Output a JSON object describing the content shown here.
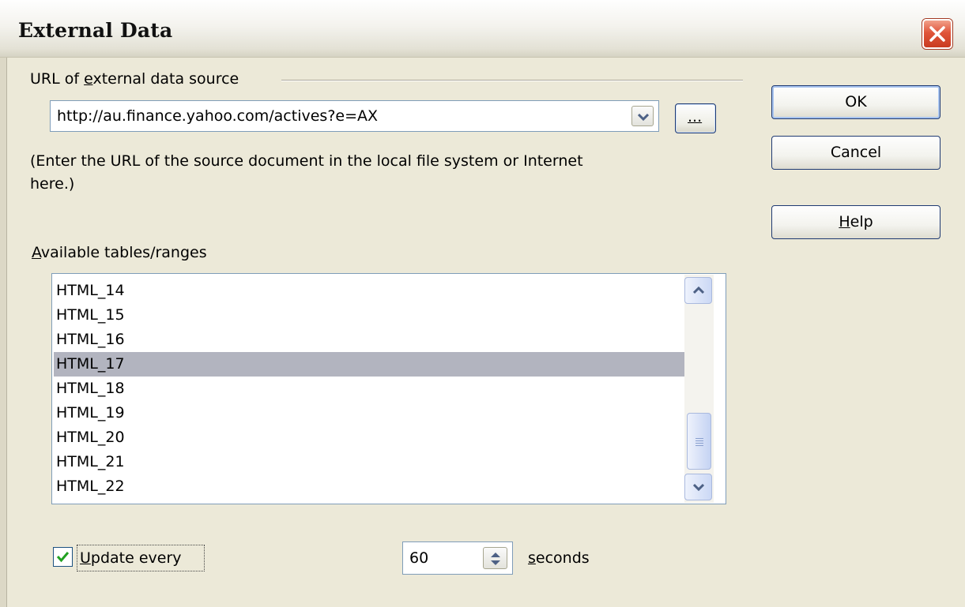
{
  "window": {
    "title": "External Data",
    "close_icon": "close-icon"
  },
  "url_group": {
    "label_pre": "URL of ",
    "label_accel": "e",
    "label_post": "xternal data source",
    "url_value": "http://au.finance.yahoo.com/actives?e=AX",
    "browse_label": "...",
    "hint_line1": "(Enter the URL of the source document in the local file system or Internet",
    "hint_line2": "here.)"
  },
  "tables": {
    "label_accel": "A",
    "label_post": "vailable tables/ranges",
    "items": [
      "HTML_14",
      "HTML_15",
      "HTML_16",
      "HTML_17",
      "HTML_18",
      "HTML_19",
      "HTML_20",
      "HTML_21",
      "HTML_22"
    ],
    "selected": "HTML_17"
  },
  "update": {
    "checked": true,
    "label_accel": "U",
    "label_post": "pdate every",
    "interval": "60",
    "unit_accel": "s",
    "unit_post": "econds"
  },
  "buttons": {
    "ok": "OK",
    "cancel": "Cancel",
    "help_accel": "H",
    "help_post": "elp"
  },
  "colors": {
    "dialog_bg": "#ece9d8",
    "selection": "#b2b4bf",
    "close_red": "#e0553a",
    "check_green": "#21a121"
  }
}
